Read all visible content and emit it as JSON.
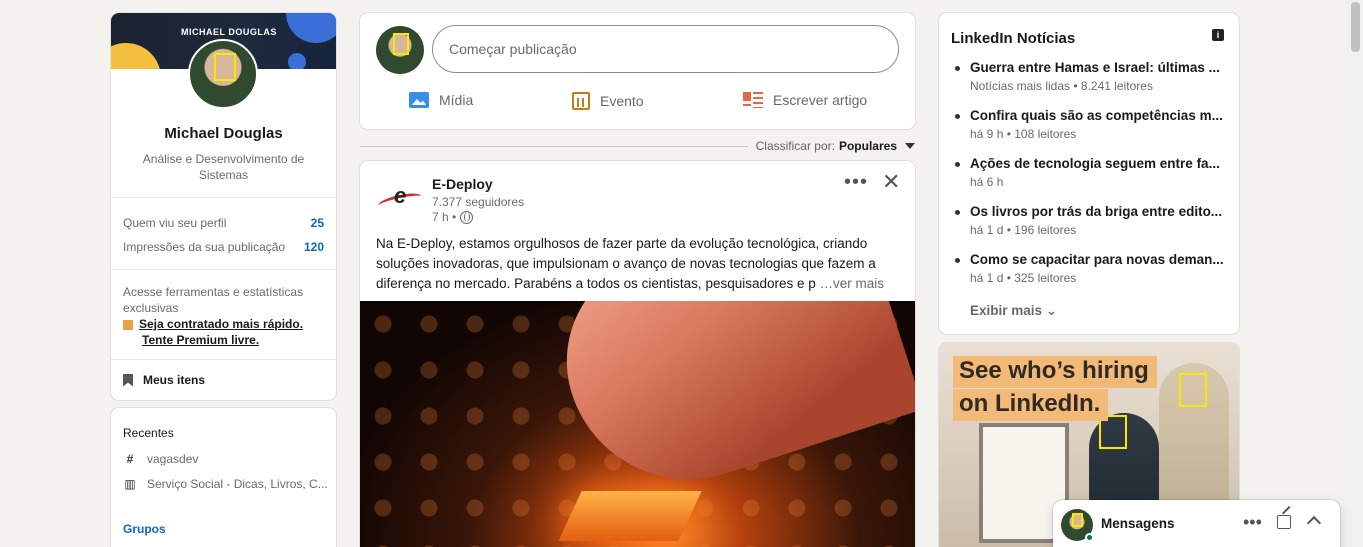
{
  "profile": {
    "banner_tag": "MICHAEL DOUGLAS",
    "name": "Michael Douglas",
    "headline": "Análise e Desenvolvimento de Sistemas",
    "stats": [
      {
        "label": "Quem viu seu perfil",
        "value": "25"
      },
      {
        "label": "Impressões da sua publicação",
        "value": "120"
      }
    ],
    "premium_text": "Acesse ferramentas e estatísticas exclusivas",
    "premium_link_1": "Seja contratado mais rápido.",
    "premium_link_2": "Tente Premium livre.",
    "my_items": "Meus itens"
  },
  "recent": {
    "heading": "Recentes",
    "items": [
      {
        "icon": "hashtag-icon",
        "label": "vagasdev"
      },
      {
        "icon": "group-icon",
        "label": "Serviço Social - Dicas, Livros, C..."
      }
    ],
    "groups_label": "Grupos"
  },
  "share": {
    "placeholder": "Começar publicação",
    "actions": [
      "Mídia",
      "Evento",
      "Escrever artigo"
    ]
  },
  "sort": {
    "label": "Classificar por:",
    "value": "Populares"
  },
  "post": {
    "author": "E-Deploy",
    "followers": "7.377 seguidores",
    "time": "7 h •",
    "text": "Na E-Deploy, estamos orgulhosos de fazer parte da evolução tecnológica, criando soluções inovadoras, que impulsionam o avanço de novas tecnologias que fazem a diferença no mercado. Parabéns a todos os cientistas, pesquisadores e p",
    "see_more": "…ver mais"
  },
  "news": {
    "title": "LinkedIn Notícias",
    "items": [
      {
        "title": "Guerra entre Hamas e Israel: últimas ...",
        "meta": "Notícias mais lidas • 8.241 leitores"
      },
      {
        "title": "Confira quais são as competências m...",
        "meta": "há 9 h • 108 leitores"
      },
      {
        "title": "Ações de tecnologia seguem entre fa...",
        "meta": "há 6 h"
      },
      {
        "title": "Os livros por trás da briga entre edito...",
        "meta": "há 1 d • 196 leitores"
      },
      {
        "title": "Como se capacitar para novas deman...",
        "meta": "há 1 d • 325 leitores"
      }
    ],
    "show_more": "Exibir mais"
  },
  "ad": {
    "line1": "See who’s hiring",
    "line2": "on LinkedIn."
  },
  "messaging": {
    "title": "Mensagens"
  }
}
